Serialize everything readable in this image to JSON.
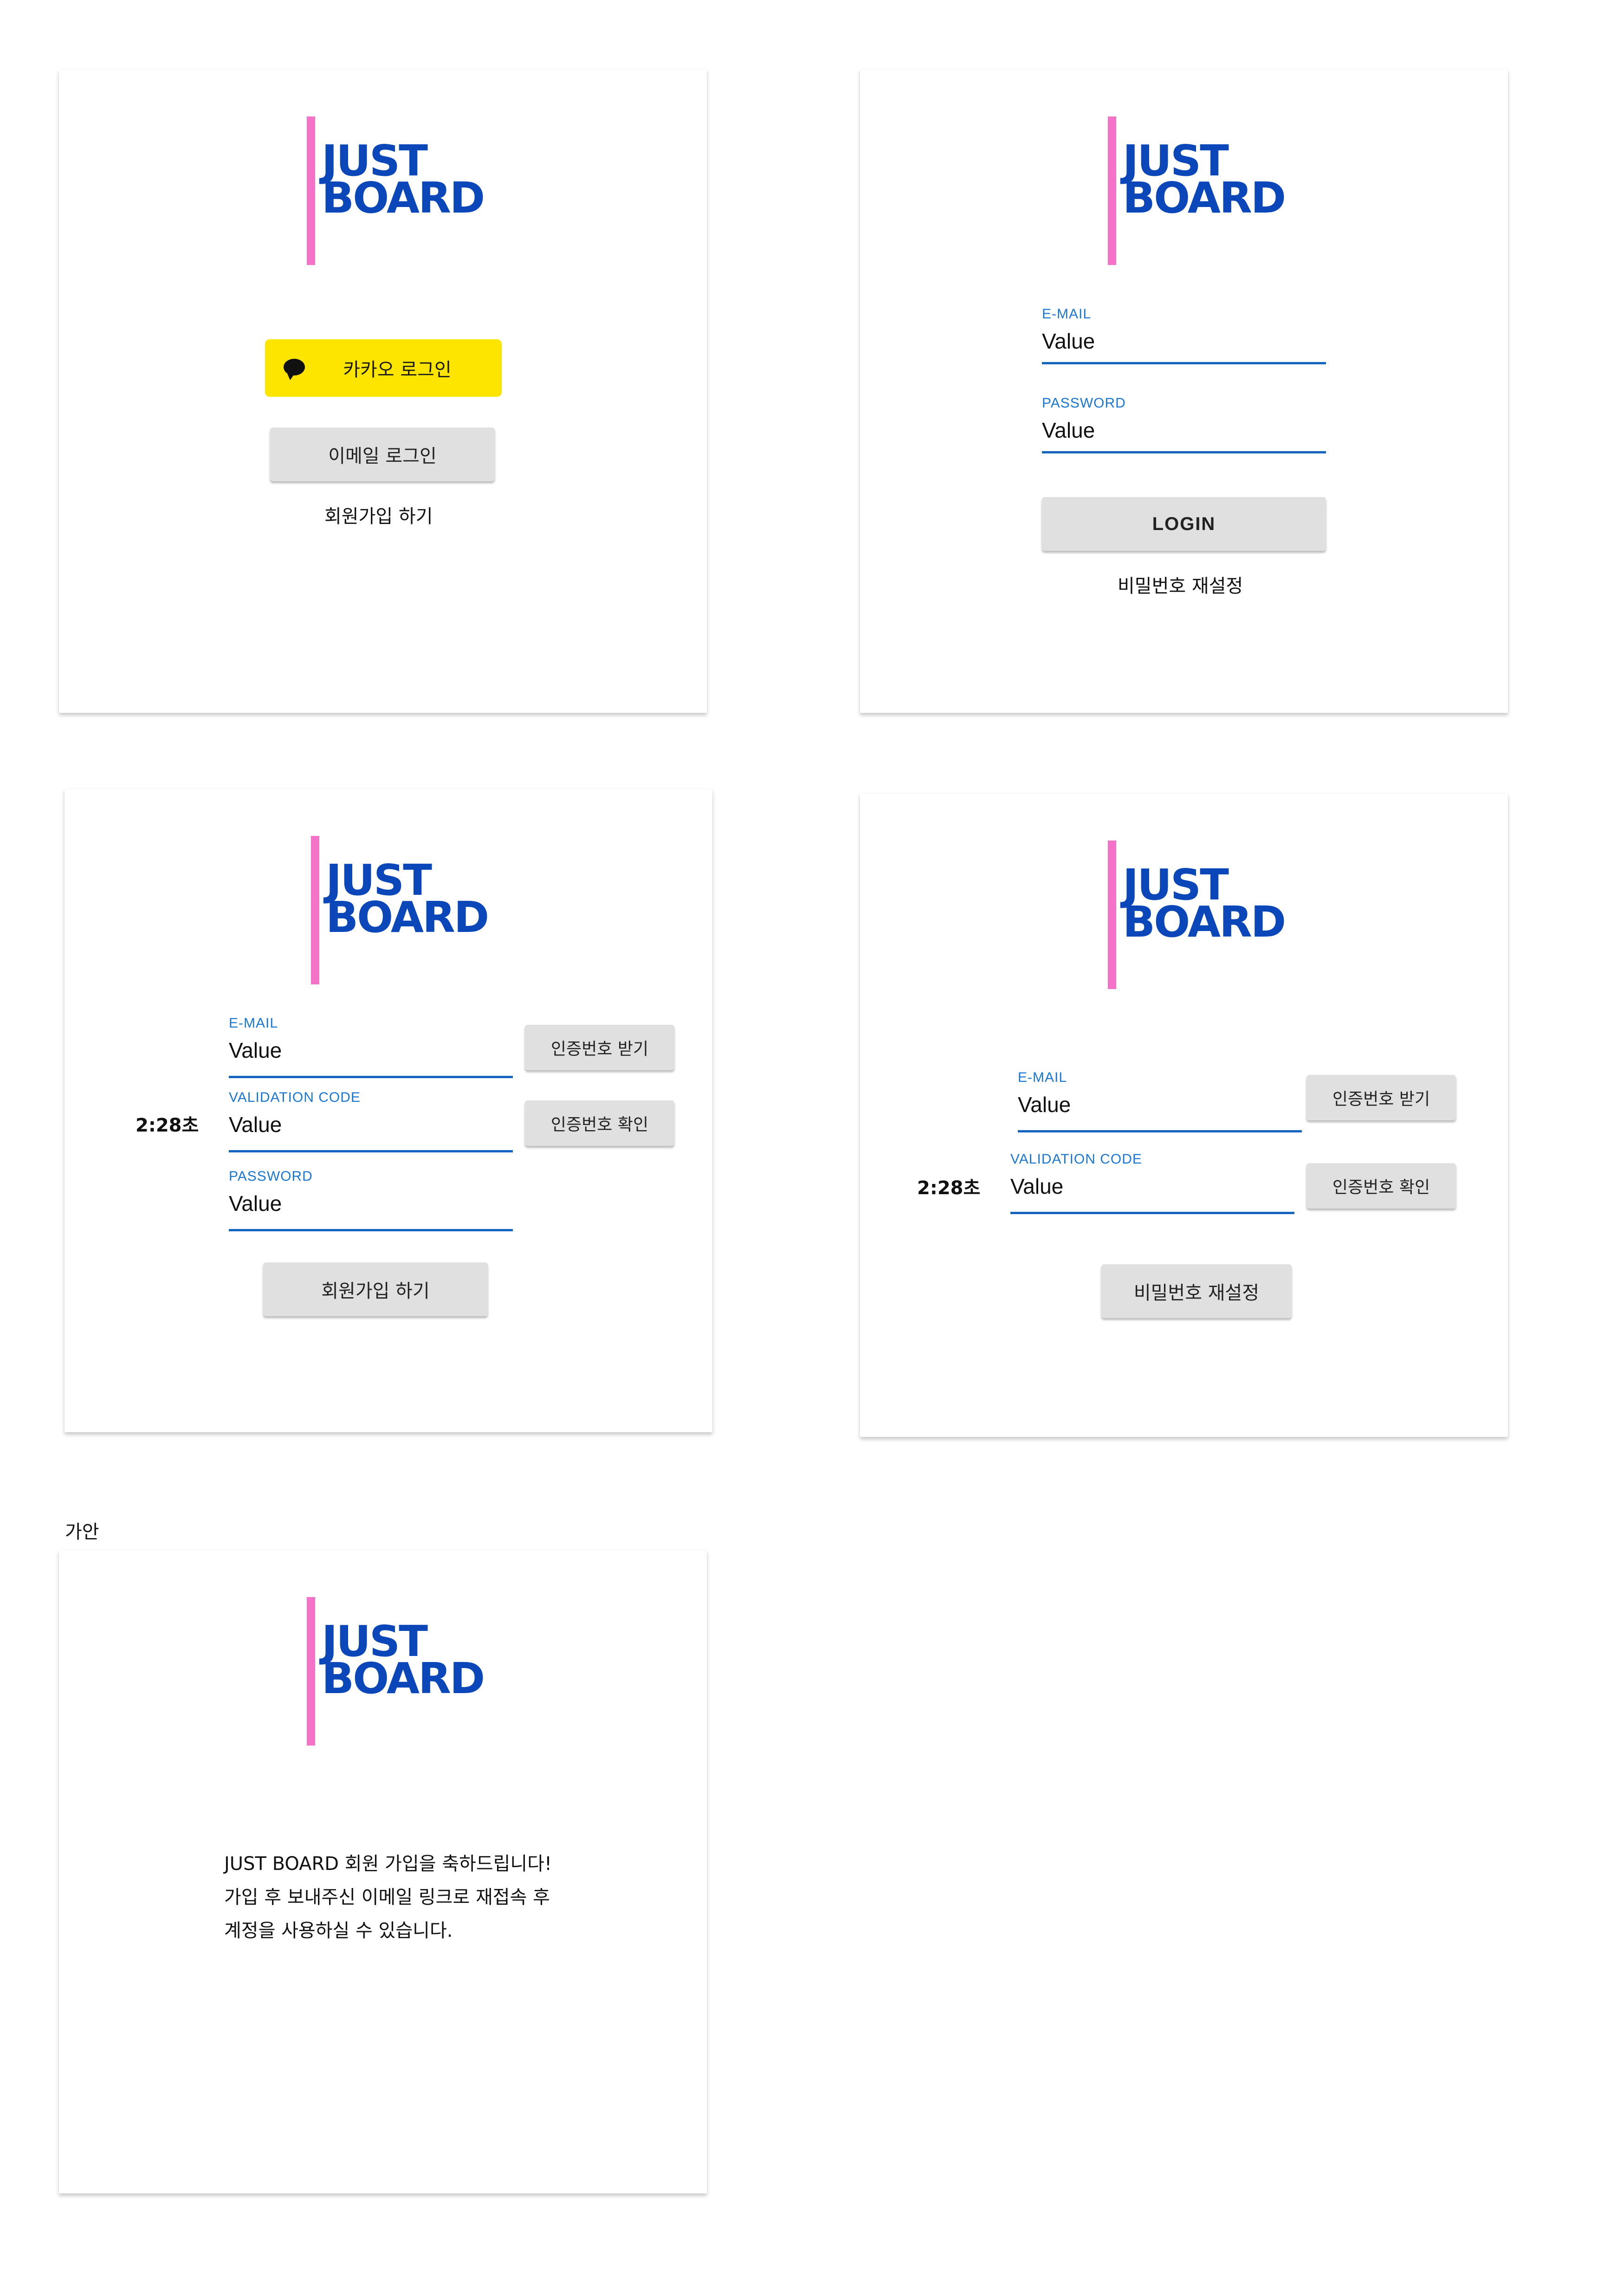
{
  "brand": {
    "line1": "JUST",
    "line2": "BOARD",
    "accent_color": "#f472c8",
    "logo_color": "#0b47b8"
  },
  "panel_start": {
    "kakao_label": "카카오 로그인",
    "kakao_icon": "chat-bubble-icon",
    "email_login_label": "이메일 로그인",
    "signup_link": "회원가입 하기"
  },
  "panel_login": {
    "email": {
      "label": "E-MAIL",
      "value": "Value"
    },
    "password": {
      "label": "PASSWORD",
      "value": "Value"
    },
    "login_label": "LOGIN",
    "reset_link": "비밀번호 재설정"
  },
  "panel_signup": {
    "timer": "2:28초",
    "email": {
      "label": "E-MAIL",
      "value": "Value"
    },
    "code": {
      "label": "VALIDATION CODE",
      "value": "Value"
    },
    "password": {
      "label": "PASSWORD",
      "value": "Value"
    },
    "get_code_label": "인증번호 받기",
    "verify_label": "인증번호 확인",
    "signup_label": "회원가입 하기"
  },
  "panel_reset": {
    "timer": "2:28초",
    "email": {
      "label": "E-MAIL",
      "value": "Value"
    },
    "code": {
      "label": "VALIDATION CODE",
      "value": "Value"
    },
    "get_code_label": "인증번호 받기",
    "verify_label": "인증번호 확인",
    "reset_label": "비밀번호 재설정"
  },
  "draft_caption": "가안",
  "panel_welcome": {
    "line1": "JUST BOARD 회원 가입을 축하드립니다!",
    "line2": "가입 후 보내주신 이메일 링크로 재접속 후",
    "line3": "계정을 사용하실 수 있습니다."
  }
}
